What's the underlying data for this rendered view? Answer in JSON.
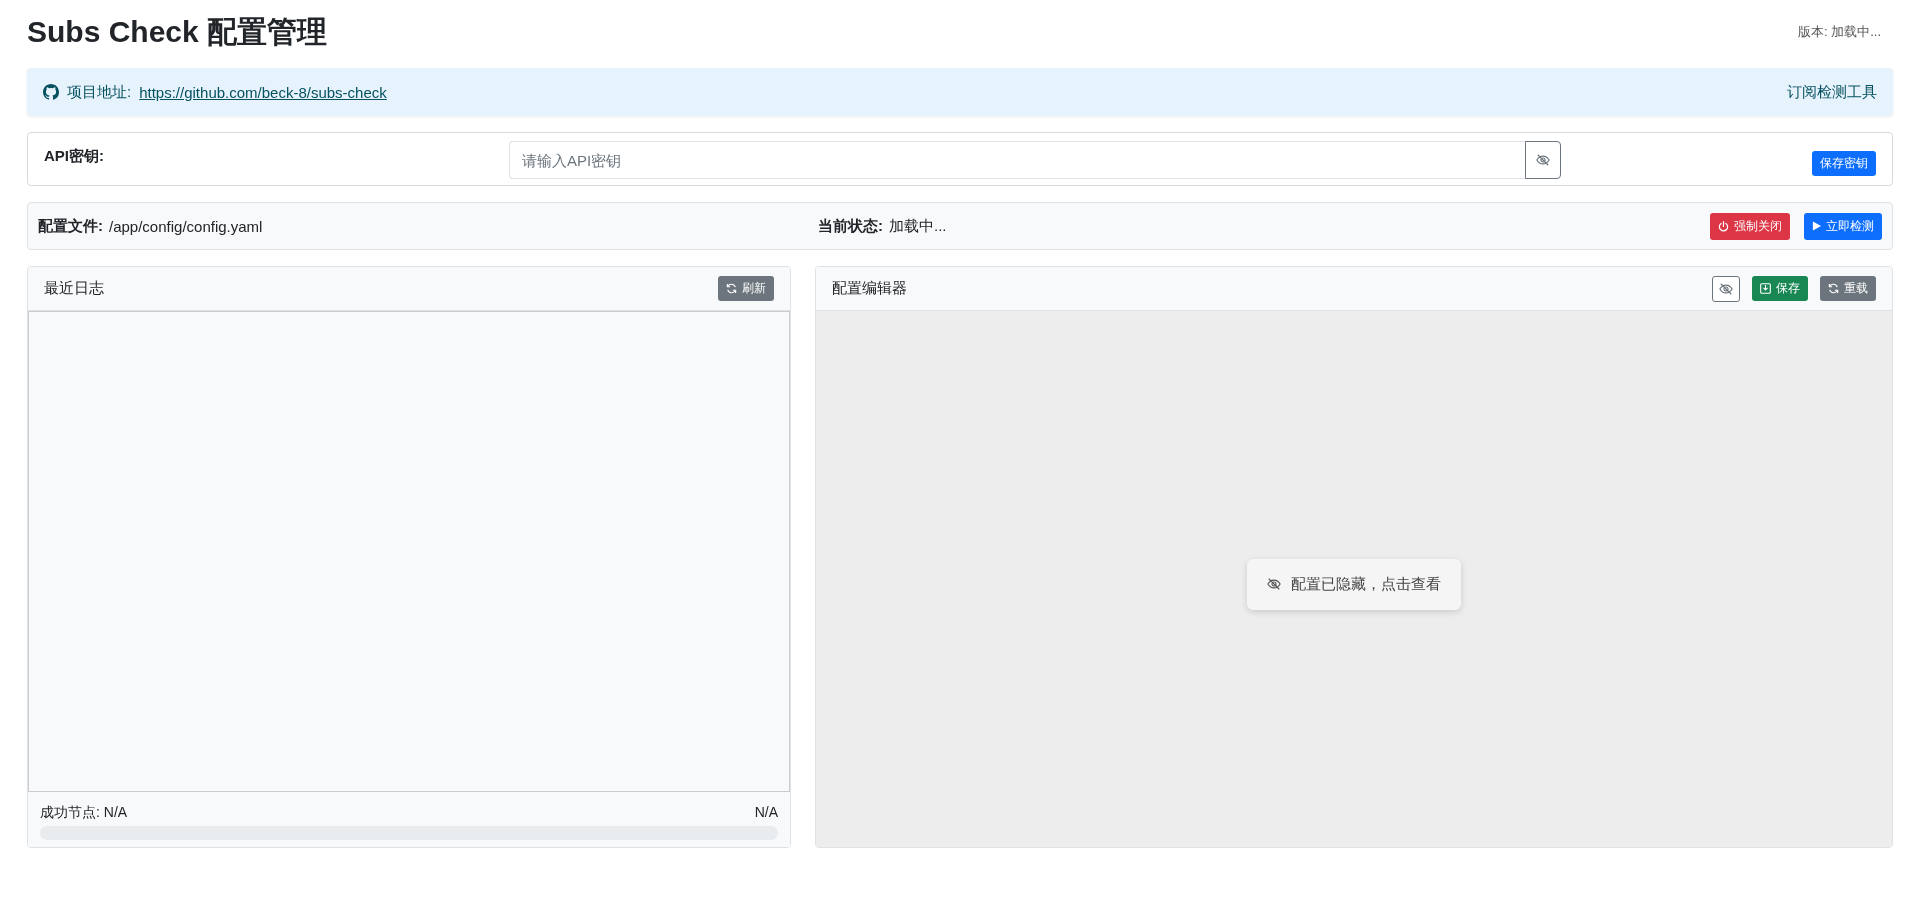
{
  "header": {
    "title": "Subs Check 配置管理",
    "version": "版本: 加载中..."
  },
  "project_bar": {
    "label": "项目地址:",
    "link": "https://github.com/beck-8/subs-check",
    "tagline": "订阅检测工具"
  },
  "api_key": {
    "label": "API密钥:",
    "placeholder": "请输入API密钥",
    "save_button": "保存密钥"
  },
  "status_bar": {
    "config_label": "配置文件:",
    "config_path": "/app/config/config.yaml",
    "status_label": "当前状态:",
    "status": "加载中...",
    "buttons": [
      {
        "label": "强制关闭",
        "kind": "danger"
      },
      {
        "label": "立即检测",
        "kind": "primary"
      }
    ]
  },
  "log_panel": {
    "title": "最近日志",
    "refresh_button": "刷新",
    "success_label": "成功节点: N/A",
    "progress_text": "N/A",
    "progress": {
      "level": 0
    }
  },
  "editor_panel": {
    "title": "配置编辑器",
    "buttons": [
      {
        "label": "保存",
        "kind": "success"
      },
      {
        "label": "重载",
        "kind": "secondary"
      }
    ],
    "hidden_notice": "配置已隐藏，点击查看"
  }
}
